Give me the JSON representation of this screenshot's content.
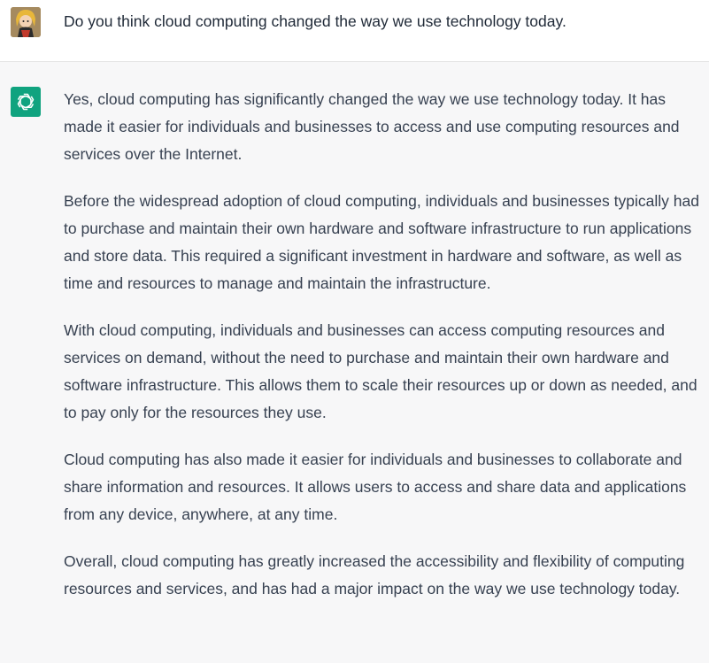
{
  "conversation": {
    "user": {
      "avatar_icon": "user-avatar-icon",
      "message": "Do you think cloud computing changed the way we use technology today."
    },
    "assistant": {
      "avatar_icon": "openai-logo-icon",
      "accent_color": "#10a37f",
      "paragraphs": [
        "Yes, cloud computing has significantly changed the way we use technology today. It has made it easier for individuals and businesses to access and use computing resources and services over the Internet.",
        "Before the widespread adoption of cloud computing, individuals and businesses typically had to purchase and maintain their own hardware and software infrastructure to run applications and store data. This required a significant investment in hardware and software, as well as time and resources to manage and maintain the infrastructure.",
        "With cloud computing, individuals and businesses can access computing resources and services on demand, without the need to purchase and maintain their own hardware and software infrastructure. This allows them to scale their resources up or down as needed, and to pay only for the resources they use.",
        "Cloud computing has also made it easier for individuals and businesses to collaborate and share information and resources. It allows users to access and share data and applications from any device, anywhere, at any time.",
        "Overall, cloud computing has greatly increased the accessibility and flexibility of computing resources and services, and has had a major impact on the way we use technology today."
      ]
    }
  }
}
